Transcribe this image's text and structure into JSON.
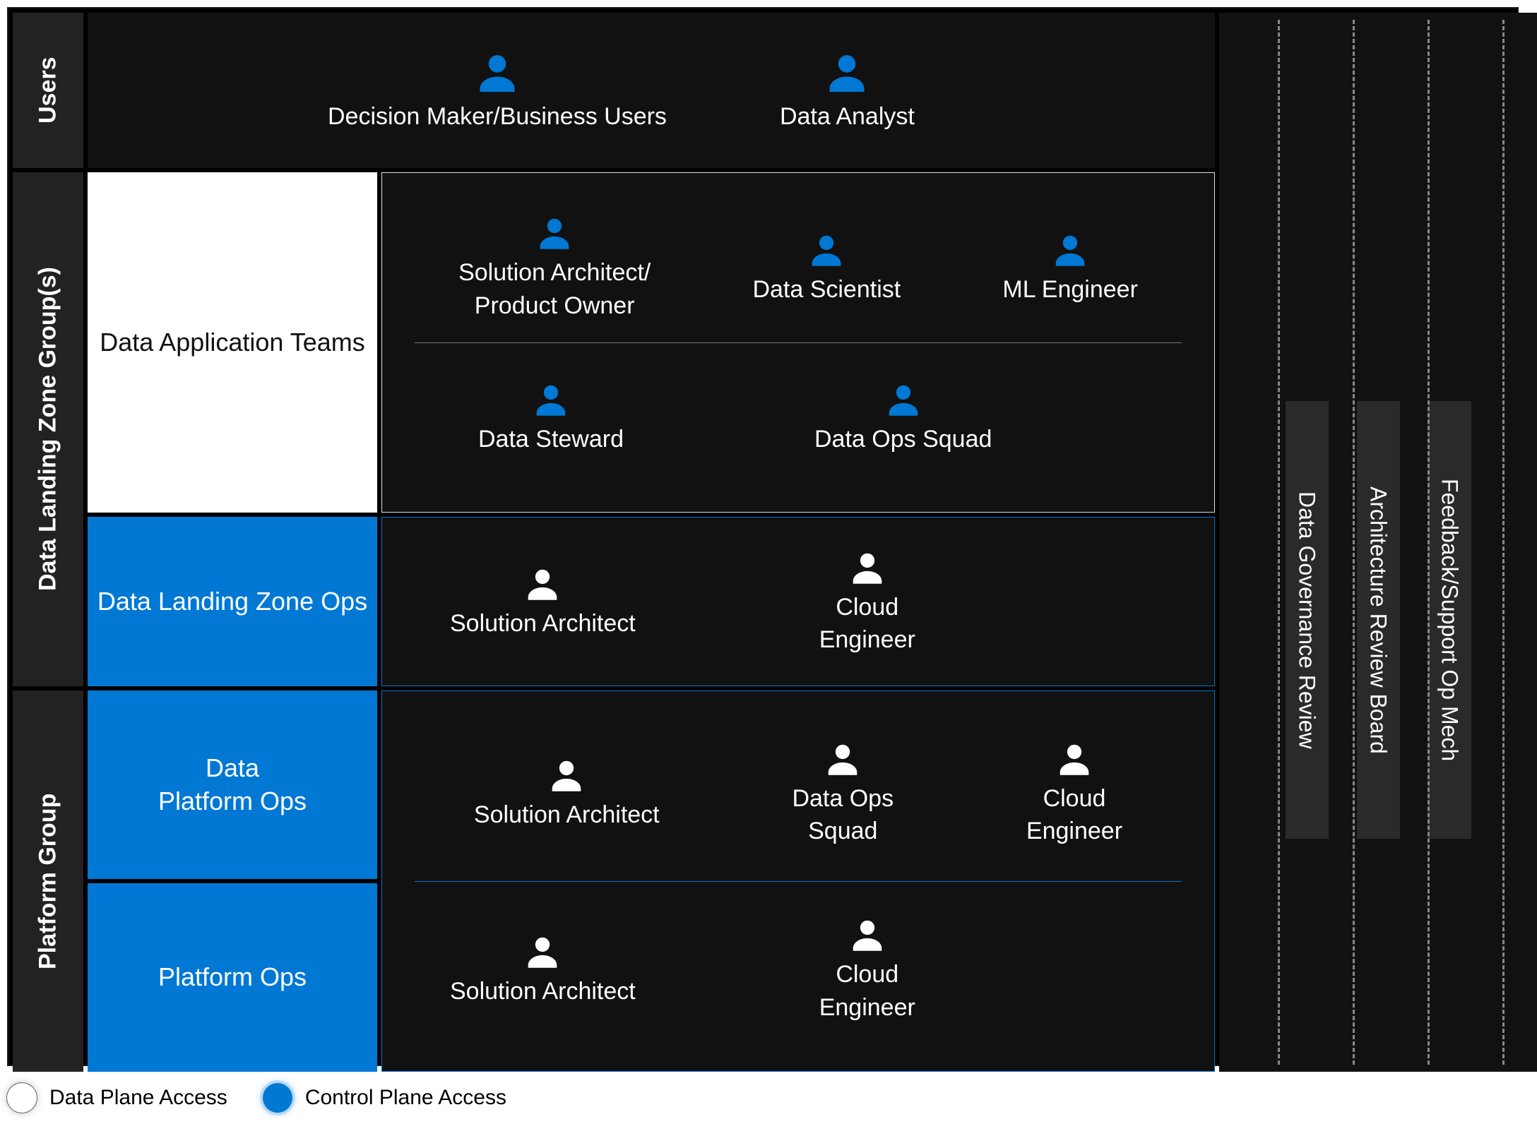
{
  "sections": {
    "users": "Users",
    "dlz": "Data Landing Zone Group(s)",
    "pg": "Platform Group"
  },
  "users_row": {
    "decision_maker": "Decision Maker/Business Users",
    "data_analyst": "Data Analyst"
  },
  "dlz_left": {
    "app_teams": "Data Application Teams",
    "zone_ops": "Data Landing Zone Ops"
  },
  "dlz_roles_top": {
    "sol_arch_po_1": "Solution Architect/",
    "sol_arch_po_2": "Product Owner",
    "data_scientist": "Data Scientist",
    "ml_engineer": "ML Engineer"
  },
  "dlz_roles_bottom": {
    "data_steward": "Data Steward",
    "data_ops": "Data Ops Squad"
  },
  "dlz_ops_roles": {
    "sol_arch": "Solution Architect",
    "cloud_eng_1": "Cloud",
    "cloud_eng_2": "Engineer"
  },
  "pg_left": {
    "data_platform_ops_1": "Data",
    "data_platform_ops_2": "Platform Ops",
    "platform_ops": "Platform Ops"
  },
  "pg_row1": {
    "sol_arch": "Solution Architect",
    "data_ops_1": "Data Ops",
    "data_ops_2": "Squad",
    "cloud_eng_1": "Cloud",
    "cloud_eng_2": "Engineer"
  },
  "pg_row2": {
    "sol_arch": "Solution Architect",
    "cloud_eng_1": "Cloud",
    "cloud_eng_2": "Engineer"
  },
  "governance": {
    "a": "Data Governance Review",
    "b": "Architecture Review Board",
    "c": "Feedback/Support Op Mech"
  },
  "legend": {
    "data_plane": "Data Plane Access",
    "control_plane": "Control Plane Access"
  }
}
